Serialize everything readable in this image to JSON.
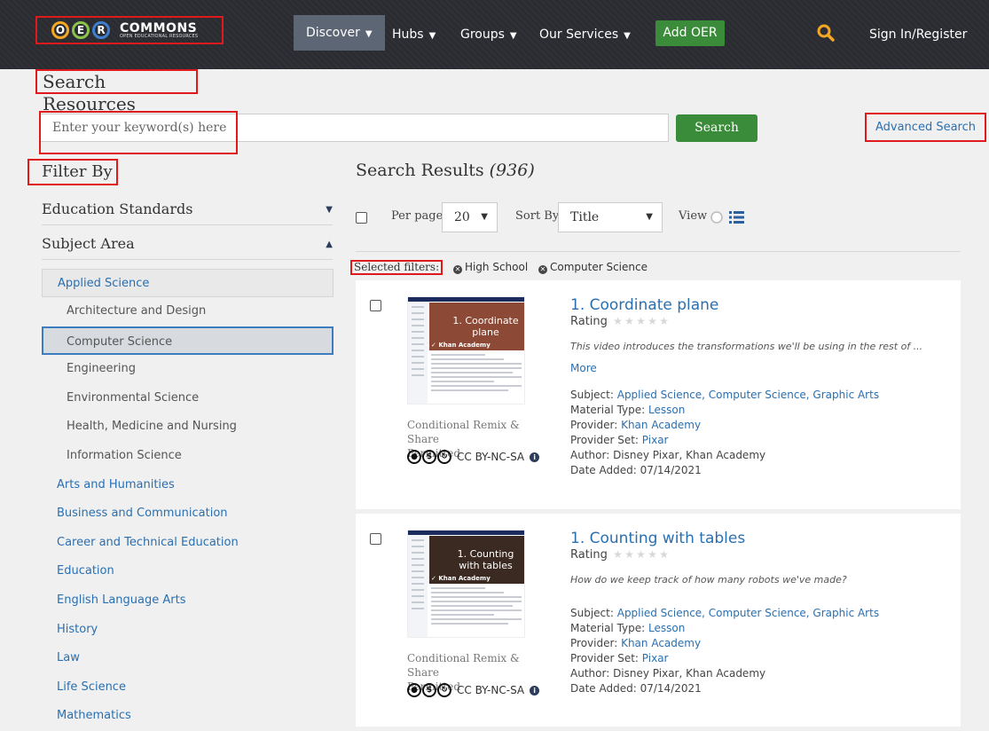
{
  "nav": {
    "logo_letters": [
      "O",
      "E",
      "R"
    ],
    "logo_word": "COMMONS",
    "logo_sub": "OPEN EDUCATIONAL RESOURCES",
    "discover": "Discover",
    "hubs": "Hubs",
    "groups": "Groups",
    "services": "Our Services",
    "add_oer": "Add OER",
    "sign_in": "Sign In/Register"
  },
  "page_title": "Search Resources",
  "search": {
    "placeholder": "Enter your keyword(s) here",
    "button": "Search",
    "advanced": "Advanced Search"
  },
  "filter": {
    "title": "Filter By",
    "education_standards": "Education Standards",
    "subject_area": "Subject Area",
    "subjects": [
      {
        "label": "Applied Science",
        "kind": "parent-open"
      },
      {
        "label": "Architecture and Design",
        "kind": "child"
      },
      {
        "label": "Computer Science",
        "kind": "selected"
      },
      {
        "label": "Engineering",
        "kind": "child"
      },
      {
        "label": "Environmental Science",
        "kind": "child"
      },
      {
        "label": "Health, Medicine and Nursing",
        "kind": "child"
      },
      {
        "label": "Information Science",
        "kind": "child"
      },
      {
        "label": "Arts and Humanities",
        "kind": "top"
      },
      {
        "label": "Business and Communication",
        "kind": "top"
      },
      {
        "label": "Career and Technical Education",
        "kind": "top"
      },
      {
        "label": "Education",
        "kind": "top"
      },
      {
        "label": "English Language Arts",
        "kind": "top"
      },
      {
        "label": "History",
        "kind": "top"
      },
      {
        "label": "Law",
        "kind": "top"
      },
      {
        "label": "Life Science",
        "kind": "top"
      },
      {
        "label": "Mathematics",
        "kind": "top"
      }
    ]
  },
  "results": {
    "title": "Search Results",
    "count": "(936)",
    "per_page_label": "Per page",
    "per_page_value": "20",
    "sort_label": "Sort By",
    "sort_value": "Title",
    "view_label": "View",
    "selected_filters_label": "Selected filters:",
    "selected_filters": [
      "High School",
      "Computer Science"
    ]
  },
  "cards": [
    {
      "thumb_title": "1. Coordinate plane",
      "thumb_brand": "Khan Academy",
      "thumb_color": "#8c4a36",
      "title": "1. Coordinate plane",
      "rating_label": "Rating",
      "description": "This video introduces the transformations we'll be using in the rest of ...",
      "more": "More",
      "license_line1": "Conditional Remix & Share",
      "license_line2": "Permitted",
      "license_code": "CC BY-NC-SA",
      "subject_label": "Subject:",
      "subjects": "Applied Science, Computer Science, Graphic Arts",
      "material_label": "Material Type:",
      "material": "Lesson",
      "provider_label": "Provider:",
      "provider": "Khan Academy",
      "provider_set_label": "Provider Set:",
      "provider_set": "Pixar",
      "author_label": "Author:",
      "author": "Disney Pixar, Khan Academy",
      "date_label": "Date Added:",
      "date": "07/14/2021"
    },
    {
      "thumb_title": "1. Counting with tables",
      "thumb_brand": "Khan Academy",
      "thumb_color": "#3a2a22",
      "title": "1. Counting with tables",
      "rating_label": "Rating",
      "description": "How do we keep track of how many robots we've made?",
      "license_line1": "Conditional Remix & Share",
      "license_line2": "Permitted",
      "license_code": "CC BY-NC-SA",
      "subject_label": "Subject:",
      "subjects": "Applied Science, Computer Science, Graphic Arts",
      "material_label": "Material Type:",
      "material": "Lesson",
      "provider_label": "Provider:",
      "provider": "Khan Academy",
      "provider_set_label": "Provider Set:",
      "provider_set": "Pixar",
      "author_label": "Author:",
      "author": "Disney Pixar, Khan Academy",
      "date_label": "Date Added:",
      "date": "07/14/2021"
    }
  ],
  "colors": {
    "accent_green": "#3a8c3a",
    "link_blue": "#2a6fb0",
    "annotation_red": "#e0191d",
    "nav_dark": "#2b2c31"
  }
}
